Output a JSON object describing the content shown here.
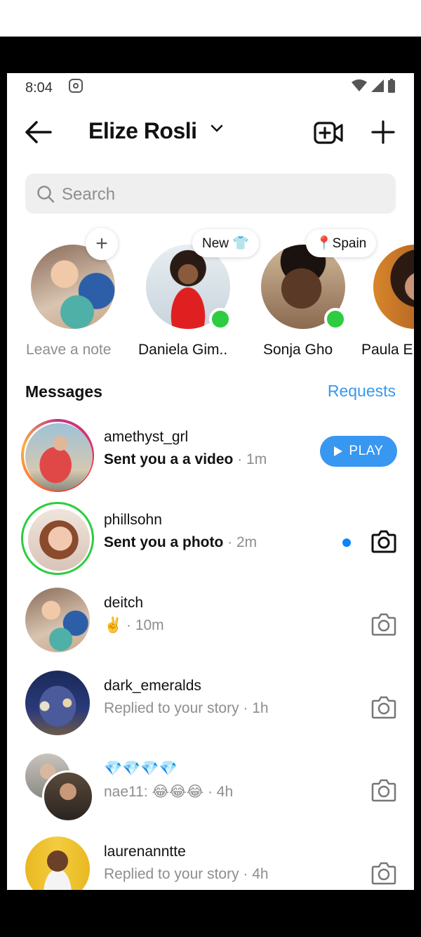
{
  "status": {
    "time": "8:04"
  },
  "header": {
    "title": "Elize Rosli"
  },
  "search": {
    "placeholder": "Search"
  },
  "notes": [
    {
      "label": "Leave a note",
      "bubble": "+"
    },
    {
      "label": "Daniela Gim..",
      "bubble": "New 👕"
    },
    {
      "label": "Sonja Gho",
      "bubble": "📍Spain"
    },
    {
      "label": "Paula E"
    }
  ],
  "messages": {
    "heading": "Messages",
    "requests": "Requests",
    "threads": [
      {
        "name": "amethyst_grl",
        "preview": "Sent you a a video",
        "time": " · 1m",
        "action": "PLAY"
      },
      {
        "name": "phillsohn",
        "preview": "Sent you a photo",
        "time": " · 2m"
      },
      {
        "name": "deitch",
        "preview": "✌️",
        "time": " · 10m"
      },
      {
        "name": "dark_emeralds",
        "preview": "Replied to your story",
        "time": " · 1h"
      },
      {
        "name": "💎💎💎💎",
        "preview": "nae11: 😂😂😂",
        "time": " · 4h"
      },
      {
        "name": "laurenanntte",
        "preview": "Replied to your story",
        "time": " · 4h"
      }
    ]
  },
  "colors": {
    "accent": "#3897f0",
    "online": "#2ecc40",
    "unread_dot": "#0a84ff"
  }
}
